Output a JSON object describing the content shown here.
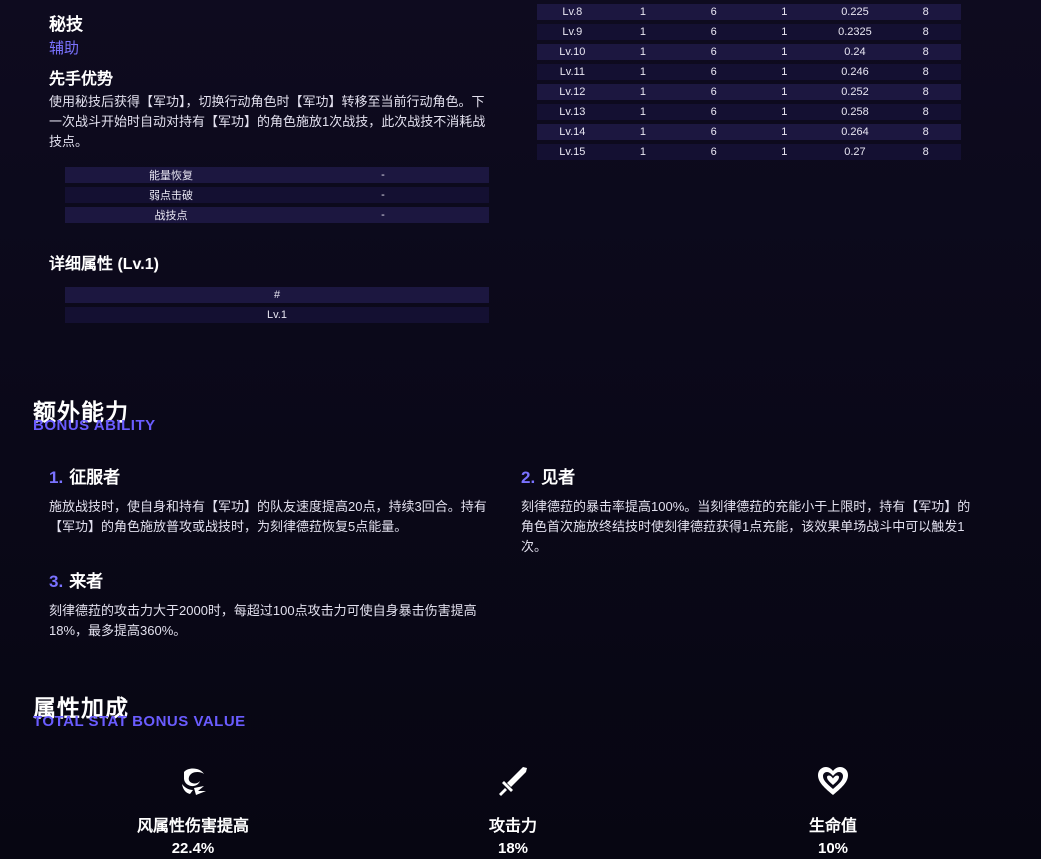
{
  "technique": {
    "heading": "秘技",
    "type": "辅助",
    "name": "先手优势",
    "description": "使用秘技后获得【军功】，切换行动角色时【军功】转移至当前行动角色。下一次战斗开始时自动对持有【军功】的角色施放1次战技，此次战技不消耗战技点。",
    "attributes": [
      {
        "label": "能量恢复",
        "value": "-"
      },
      {
        "label": "弱点击破",
        "value": "-"
      },
      {
        "label": "战技点",
        "value": "-"
      }
    ]
  },
  "detail": {
    "title": "详细属性 (Lv.1)",
    "header": "#",
    "rows": [
      "Lv.1"
    ]
  },
  "level_table": [
    [
      "Lv.8",
      "1",
      "6",
      "1",
      "0.225",
      "8"
    ],
    [
      "Lv.9",
      "1",
      "6",
      "1",
      "0.2325",
      "8"
    ],
    [
      "Lv.10",
      "1",
      "6",
      "1",
      "0.24",
      "8"
    ],
    [
      "Lv.11",
      "1",
      "6",
      "1",
      "0.246",
      "8"
    ],
    [
      "Lv.12",
      "1",
      "6",
      "1",
      "0.252",
      "8"
    ],
    [
      "Lv.13",
      "1",
      "6",
      "1",
      "0.258",
      "8"
    ],
    [
      "Lv.14",
      "1",
      "6",
      "1",
      "0.264",
      "8"
    ],
    [
      "Lv.15",
      "1",
      "6",
      "1",
      "0.27",
      "8"
    ]
  ],
  "bonus_ability": {
    "title": "额外能力",
    "subtitle": "BONUS ABILITY",
    "items": [
      {
        "num": "1.",
        "name": "征服者",
        "desc": "施放战技时，使自身和持有【军功】的队友速度提高20点，持续3回合。持有【军功】的角色施放普攻或战技时，为刻律德菈恢复5点能量。"
      },
      {
        "num": "2.",
        "name": "见者",
        "desc": "刻律德菈的暴击率提高100%。当刻律德菈的充能小于上限时，持有【军功】的角色首次施放终结技时使刻律德菈获得1点充能，该效果单场战斗中可以触发1次。"
      },
      {
        "num": "3.",
        "name": "来者",
        "desc": "刻律德菈的攻击力大于2000时，每超过100点攻击力可使自身暴击伤害提高18%，最多提高360%。"
      }
    ]
  },
  "stat_bonus": {
    "title": "属性加成",
    "subtitle": "TOTAL STAT BONUS VALUE",
    "items": [
      {
        "icon": "wind-damage-icon",
        "name": "风属性伤害提高",
        "value": "22.4%"
      },
      {
        "icon": "attack-sword-icon",
        "name": "攻击力",
        "value": "18%"
      },
      {
        "icon": "hp-heart-icon",
        "name": "生命值",
        "value": "10%"
      }
    ]
  }
}
